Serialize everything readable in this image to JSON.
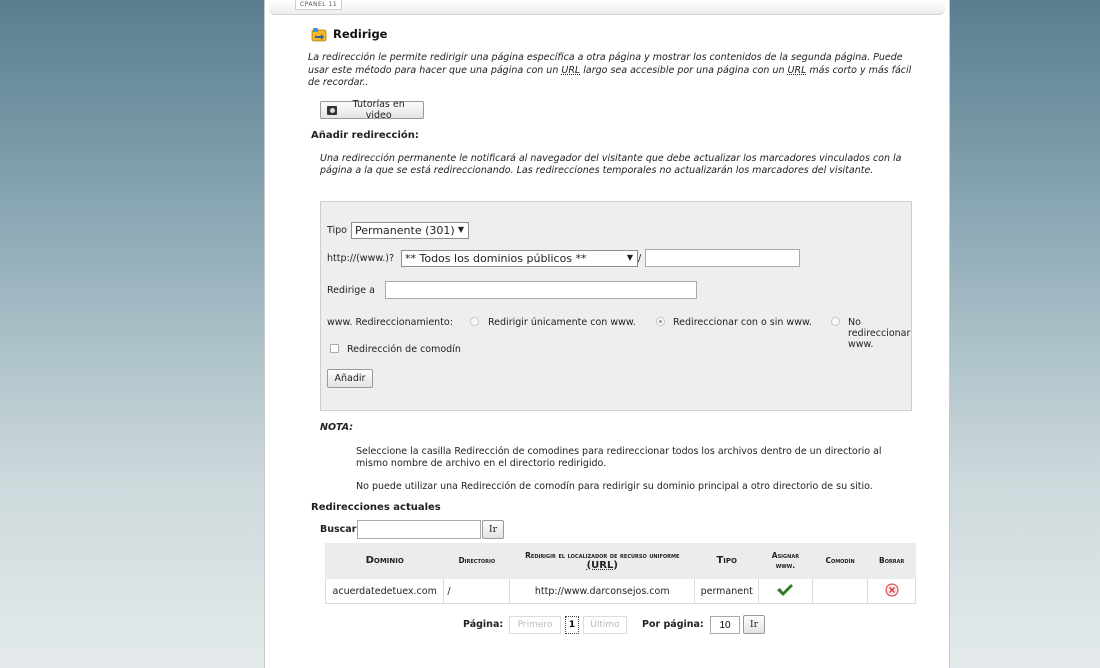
{
  "brand": "CPANEL 11",
  "page": {
    "title": "Redirige",
    "intro_pre": "La redirección le permite redirigir una página específica a otra página y mostrar los contenidos de la segunda página. Puede usar este método para hacer que una página con un ",
    "intro_abbr1": "URL",
    "intro_mid": " largo sea accesible por una página con un ",
    "intro_abbr2": "URL",
    "intro_post": " más corto y más fácil de recordar..",
    "video_button": "Tutorías en video"
  },
  "add_section": {
    "heading": "Añadir redirección:",
    "description": "Una redirección permanente le notificará al navegador del visitante que debe actualizar los marcadores vinculados con la página a la que se está redireccionando. Las redirecciones temporales no actualizarán los marcadores del visitante."
  },
  "form": {
    "tipo_label": "Tipo",
    "tipo_value": "Permanente (301)",
    "http_prefix": "http://(www.)?",
    "domain_value": "** Todos los dominios públicos **",
    "slash": "/",
    "path_value": "",
    "redirect_label": "Redirige a",
    "redirect_value": "",
    "www_label": "www. Redireccionamiento:",
    "www_options": [
      "Redirigir únicamente con www.",
      "Redireccionar con o sin www.",
      "No redireccionar www."
    ],
    "www_selected": 1,
    "wildcard_label": "Redirección de comodín",
    "wildcard_checked": false,
    "submit_label": "Añadir"
  },
  "nota": {
    "title": "NOTA:",
    "p1": "Seleccione la casilla Redirección de comodines para redireccionar todos los archivos dentro de un directorio al mismo nombre de archivo en el directorio redirigido.",
    "p2": "No puede utilizar una Redirección de comodín para redirigir su dominio principal a otro directorio de su sitio."
  },
  "current": {
    "heading": "Redirecciones actuales",
    "search_label": "Buscar",
    "search_value": "",
    "search_button": "Ir",
    "columns": {
      "domain": "Dominio",
      "directory": "Directorio",
      "url_pre": "Redirigir el localizador de recurso uniforme",
      "url_abbr": "(URL)",
      "type": "Tipo",
      "www": "Asignar www.",
      "wildcard": "Comodín",
      "delete": "Borrar"
    },
    "rows": [
      {
        "domain": "acuerdatedetuex.com",
        "directory": "/",
        "url": "http://www.darconsejos.com",
        "type": "permanent",
        "www": true,
        "wildcard": false
      }
    ]
  },
  "pagination": {
    "page_label": "Página:",
    "first": "Primero",
    "current_page": "1",
    "last": "Último",
    "per_page_label": "Por página:",
    "per_page_value": "10",
    "go_button": "Ir"
  },
  "colors": {
    "check": "#2e7d1e",
    "delete": "#d63a3a"
  }
}
